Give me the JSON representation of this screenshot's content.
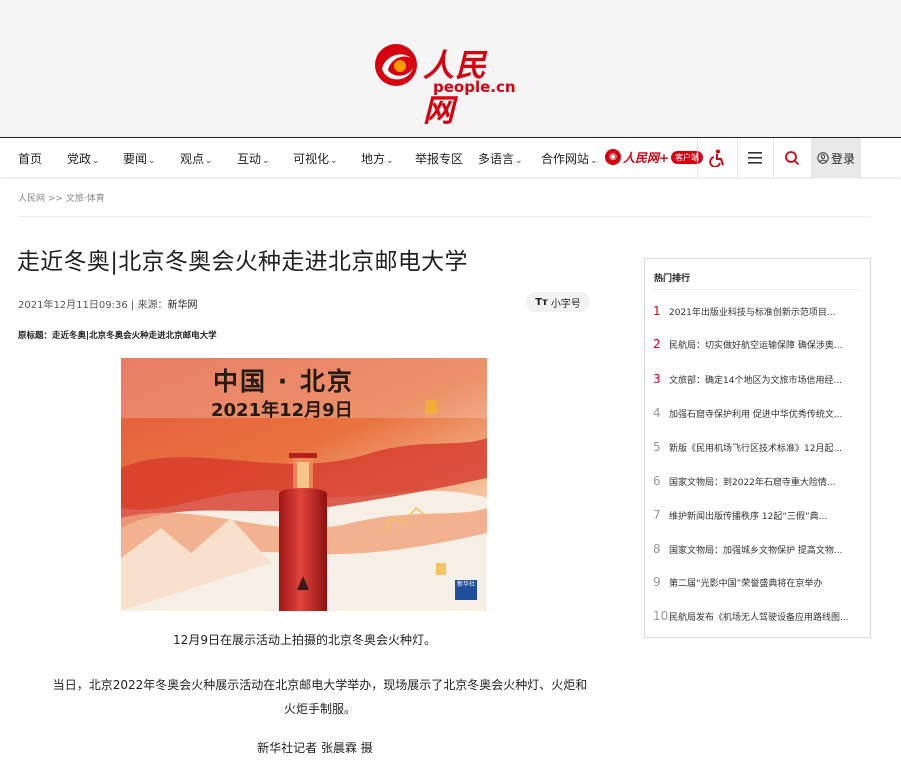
{
  "header": {
    "logo_cn": "人民网",
    "logo_en": "people.cn"
  },
  "nav": {
    "items": [
      {
        "label": "首页",
        "chevron": false
      },
      {
        "label": "党政",
        "chevron": true
      },
      {
        "label": "要闻",
        "chevron": true
      },
      {
        "label": "观点",
        "chevron": true
      },
      {
        "label": "互动",
        "chevron": true
      },
      {
        "label": "可视化",
        "chevron": true
      },
      {
        "label": "地方",
        "chevron": true
      },
      {
        "label": "举报专区",
        "chevron": false
      },
      {
        "label": "多语言",
        "chevron": true
      },
      {
        "label": "合作网站",
        "chevron": true
      }
    ],
    "chevron_glyph": "⌄",
    "app_name": "人民网+",
    "app_pill": "客户端",
    "icons": [
      "accessibility-icon",
      "menu-icon",
      "search-icon",
      "user-icon"
    ],
    "login_label": "登录"
  },
  "breadcrumb": {
    "home": "人民网",
    "sep": ">>",
    "section": "文旅·体育"
  },
  "article": {
    "title": "走近冬奥|北京冬奥会火种走进北京邮电大学",
    "date": "2021年12月11日09:36",
    "source_label": " | 来源：",
    "source": "新华网",
    "font_size_icon": "Tт",
    "font_size_label": "小字号",
    "orig_title": "原标题：走近冬奥|北京冬奥会火种走进北京邮电大学",
    "photo_line1": "中国 · 北京",
    "photo_line2": "2021年12月9日",
    "photo_watermark": "新华社",
    "caption": "12月9日在展示活动上拍摄的北京冬奥会火种灯。",
    "paragraph": "当日，北京2022年冬奥会火种展示活动在北京邮电大学举办，现场展示了北京冬奥会火种灯、火炬和火炬手制服。",
    "credit": "新华社记者 张晨霖 摄"
  },
  "sidebar": {
    "title": "热门排行",
    "items": [
      {
        "rank": "1",
        "text": "2021年出版业科技与标准创新示范项目..."
      },
      {
        "rank": "2",
        "text": "民航局：切实做好航空运输保障 确保涉奥..."
      },
      {
        "rank": "3",
        "text": "文旅部：确定14个地区为文旅市场信用经..."
      },
      {
        "rank": "4",
        "text": "加强石窟寺保护利用 促进中华优秀传统文..."
      },
      {
        "rank": "5",
        "text": "新版《民用机场飞行区技术标准》12月起..."
      },
      {
        "rank": "6",
        "text": "国家文物局：到2022年石窟寺重大险情..."
      },
      {
        "rank": "7",
        "text": "维护新闻出版传播秩序 12起“三假”典..."
      },
      {
        "rank": "8",
        "text": "国家文物局：加强城乡文物保护 提高文物..."
      },
      {
        "rank": "9",
        "text": "第二届“光影中国”荣誉盛典将在京举办"
      },
      {
        "rank": "10",
        "text": "民航局发布《机场无人驾驶设备应用路线图..."
      }
    ]
  },
  "colors": {
    "brand_red": "#d7000f"
  }
}
